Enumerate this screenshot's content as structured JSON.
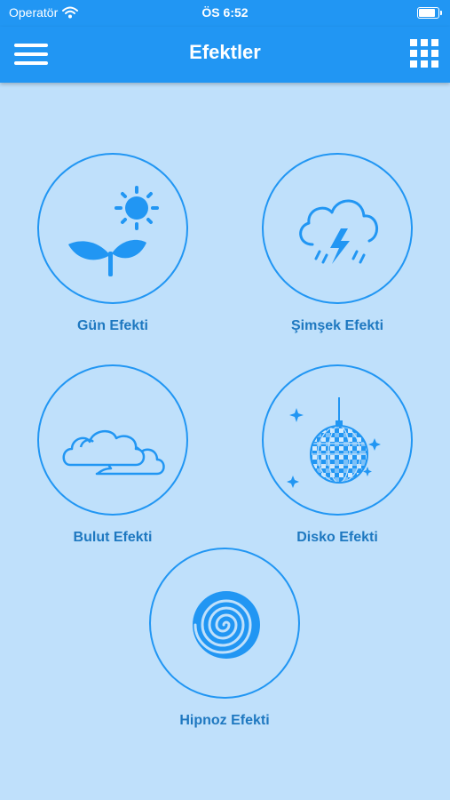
{
  "status_bar": {
    "carrier": "Operatör",
    "time": "ÖS 6:52",
    "battery_level": 0.9
  },
  "nav": {
    "title": "Efektler",
    "menu_icon": "hamburger-icon",
    "grid_icon": "grid-icon"
  },
  "effects": [
    {
      "label": "Gün Efekti",
      "icon": "sun-plant-icon"
    },
    {
      "label": "Şimşek Efekti",
      "icon": "thunderstorm-icon"
    },
    {
      "label": "Bulut Efekti",
      "icon": "clouds-icon"
    },
    {
      "label": "Disko Efekti",
      "icon": "disco-ball-icon"
    },
    {
      "label": "Hipnoz Efekti",
      "icon": "spiral-icon"
    }
  ],
  "colors": {
    "primary": "#2196f3",
    "background": "#bfe0fb",
    "label": "#1e78c0"
  }
}
